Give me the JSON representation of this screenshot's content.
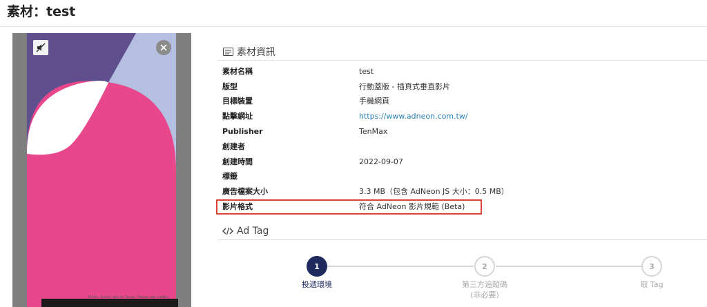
{
  "page": {
    "title": "素材：test"
  },
  "preview": {
    "mute_icon": "speaker-muted-icon",
    "close_icon": "close-icon",
    "caption": "Music: Sunny day by Tunes. Please see credits",
    "colors": {
      "bg": "#7f7f7f",
      "purple": "#5f4f8f",
      "lavender": "#b5bfe2",
      "pink": "#e8478c",
      "white": "#ffffff"
    }
  },
  "info": {
    "heading": "素材資訊",
    "heading_icon": "card-icon",
    "rows": [
      {
        "label": "素材名稱",
        "value": "test"
      },
      {
        "label": "版型",
        "value": "行動蓋版 - 插頁式垂直影片"
      },
      {
        "label": "目標裝置",
        "value": "手機網頁"
      },
      {
        "label": "點擊網址",
        "value": "https://www.adneon.com.tw/"
      },
      {
        "label": "Publisher",
        "value": "TenMax"
      },
      {
        "label": "創建者",
        "value": ""
      },
      {
        "label": "創建時間",
        "value": "2022-09-07"
      },
      {
        "label": "標籤",
        "value": ""
      },
      {
        "label": "廣告檔案大小",
        "value": "3.3 MB（包含 AdNeon JS 大小：0.5 MB）"
      },
      {
        "label": "影片格式",
        "value": "符合 AdNeon 影片規範 (Beta)"
      }
    ]
  },
  "adtag": {
    "heading": "Ad Tag",
    "heading_icon": "code-icon",
    "steps": [
      {
        "number": "1",
        "label": "投遞環境",
        "sublabel": "",
        "state": "active"
      },
      {
        "number": "2",
        "label": "第三方追蹤碼",
        "sublabel": "(非必要)",
        "state": "inactive"
      },
      {
        "number": "3",
        "label": "取 Tag",
        "sublabel": "",
        "state": "inactive"
      }
    ]
  },
  "colors": {
    "accent": "#1e2a5e",
    "link": "#2a7fb8",
    "highlight": "#d94437"
  }
}
